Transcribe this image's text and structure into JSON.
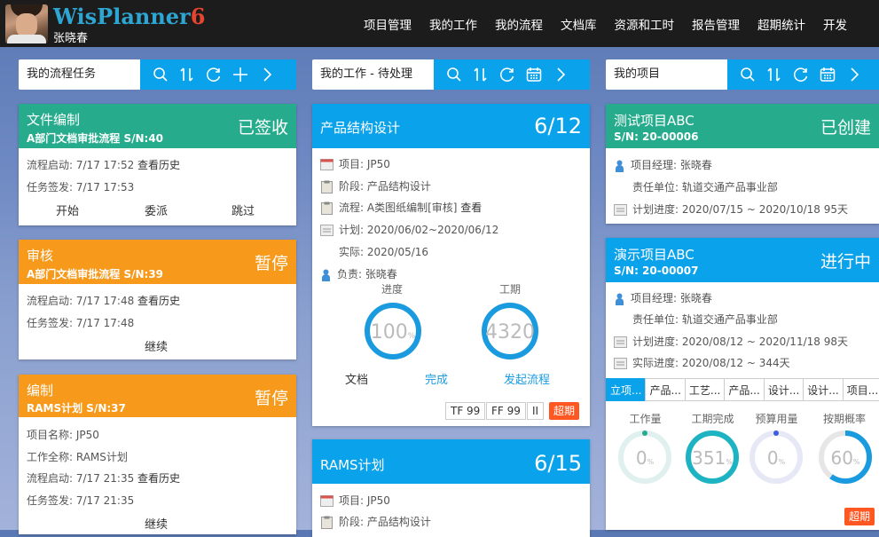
{
  "app": {
    "logo_main": "WisPlanner",
    "logo_version": "6",
    "user_name": "张晓春"
  },
  "nav": [
    "项目管理",
    "我的工作",
    "我的流程",
    "文档库",
    "资源和工时",
    "报告管理",
    "超期统计",
    "开发"
  ],
  "colors": {
    "teal": "#26ac8c",
    "orange": "#f7991a",
    "blue": "#0aa2ea",
    "overdue": "#ff5722"
  },
  "icons": [
    "search-icon",
    "sort-icon",
    "refresh-icon",
    "add-icon",
    "next-icon",
    "calendar-icon"
  ],
  "flow_panel": {
    "title": "我的流程任务",
    "cards": [
      {
        "title": "文件编制",
        "subtitle": "A部门文档审批流程 S/N:40",
        "status": "已签收",
        "start_label": "流程启动:",
        "start_time": "7/17 17:52",
        "history": "查看历史",
        "issue_label": "任务签发:",
        "issue_time": "7/17 17:53",
        "actions": [
          "开始",
          "委派",
          "跳过"
        ]
      },
      {
        "title": "审核",
        "subtitle": "A部门文档审批流程 S/N:39",
        "status": "暂停",
        "start_label": "流程启动:",
        "start_time": "7/17 17:48",
        "history": "查看历史",
        "issue_label": "任务签发:",
        "issue_time": "7/17 17:48",
        "actions": [
          "继续"
        ]
      },
      {
        "title": "编制",
        "subtitle": "RAMS计划 S/N:37",
        "status": "暂停",
        "project_label": "项目名称:",
        "project": "JP50",
        "work_label": "工作全称:",
        "work": "RAMS计划",
        "start_label": "流程启动:",
        "start_time": "7/17 21:35",
        "history": "查看历史",
        "issue_label": "任务签发:",
        "issue_time": "7/17 21:35",
        "actions": [
          "继续"
        ]
      }
    ]
  },
  "work_panel": {
    "title": "我的工作 - 待处理",
    "cards": [
      {
        "title": "产品结构设计",
        "count": "6/12",
        "project_label": "项目:",
        "project": "JP50",
        "stage_label": "阶段:",
        "stage": "产品结构设计",
        "flow_label": "流程:",
        "flow": "A类图纸编制[审核]",
        "view": "查看",
        "plan_label": "计划:",
        "plan": "2020/06/02~2020/06/12",
        "actual_label": "实际:",
        "actual": "2020/05/16",
        "owner_label": "负责:",
        "owner": "张晓春",
        "gauge1_label": "进度",
        "gauge1_value": "100",
        "gauge1_unit": "%",
        "gauge1_fraction": 1.0,
        "gauge2_label": "工期",
        "gauge2_value": "4320",
        "gauge2_fraction": 1.0,
        "doc": "文档",
        "done": "完成",
        "launch": "发起流程",
        "tags": [
          "TF 99",
          "FF 99",
          "II"
        ],
        "overdue": "超期"
      },
      {
        "title": "RAMS计划",
        "count": "6/15",
        "project_label": "项目:",
        "project": "JP50",
        "stage_label": "阶段:",
        "stage": "产品结构设计"
      }
    ]
  },
  "project_panel": {
    "title": "我的项目",
    "cards": [
      {
        "title": "测试项目ABC",
        "sn": "S/N: 20-00006",
        "status": "已创建",
        "manager_label": "项目经理:",
        "manager": "张晓春",
        "unit_label": "责任单位:",
        "unit": "轨道交通产品事业部",
        "plan_label": "计划进度:",
        "plan": "2020/07/15 ~ 2020/10/18 95天"
      },
      {
        "title": "演示项目ABC",
        "sn": "S/N: 20-00007",
        "status": "进行中",
        "manager_label": "项目经理:",
        "manager": "张晓春",
        "unit_label": "责任单位:",
        "unit": "轨道交通产品事业部",
        "plan_label": "计划进度:",
        "plan": "2020/08/12 ~ 2020/11/18 98天",
        "actual_label": "实际进度:",
        "actual": "2020/08/12 ~ 344天",
        "tabs": [
          "立项...",
          "产品...",
          "工艺...",
          "产品...",
          "设计...",
          "设计...",
          "项目..."
        ],
        "gauges": [
          {
            "label": "工作量",
            "value": "0",
            "unit": "%",
            "fraction": 0.0
          },
          {
            "label": "工期完成",
            "value": "351",
            "unit": "%",
            "fraction": 1.0
          },
          {
            "label": "预算用量",
            "value": "0",
            "unit": "%",
            "fraction": 0.0
          },
          {
            "label": "按期概率",
            "value": "60",
            "unit": "%",
            "fraction": 0.6
          }
        ],
        "overdue": "超期"
      }
    ]
  }
}
